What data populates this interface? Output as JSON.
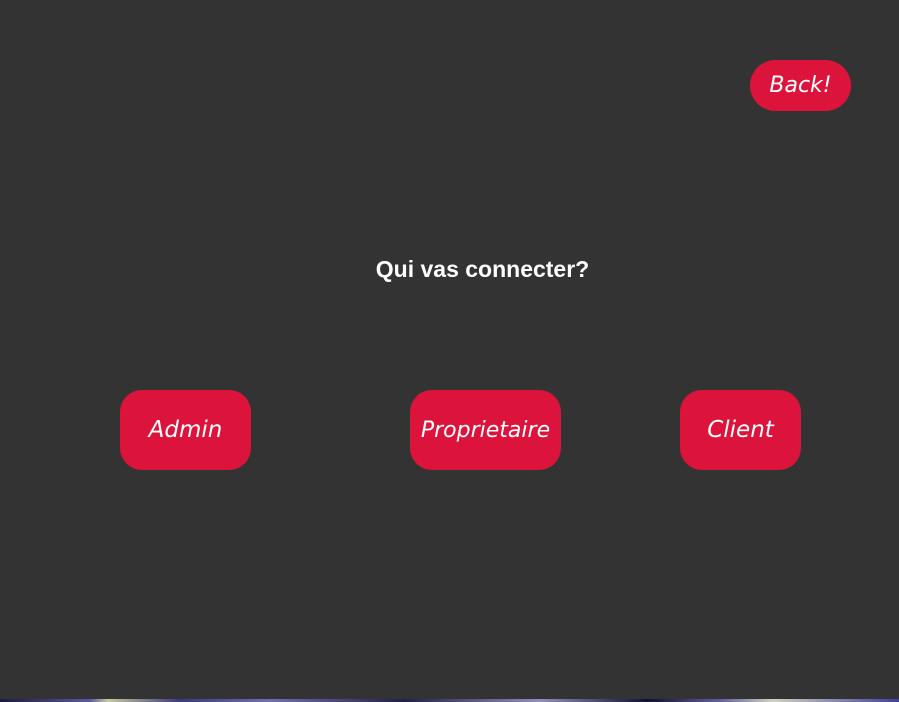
{
  "header": {
    "back_label": "Back!"
  },
  "main": {
    "prompt": "Qui vas connecter?",
    "roles": [
      {
        "label": "Admin"
      },
      {
        "label": "Proprietaire"
      },
      {
        "label": "Client"
      }
    ]
  },
  "colors": {
    "background": "#333333",
    "accent": "#DC143C",
    "text": "#FFFFFF"
  }
}
